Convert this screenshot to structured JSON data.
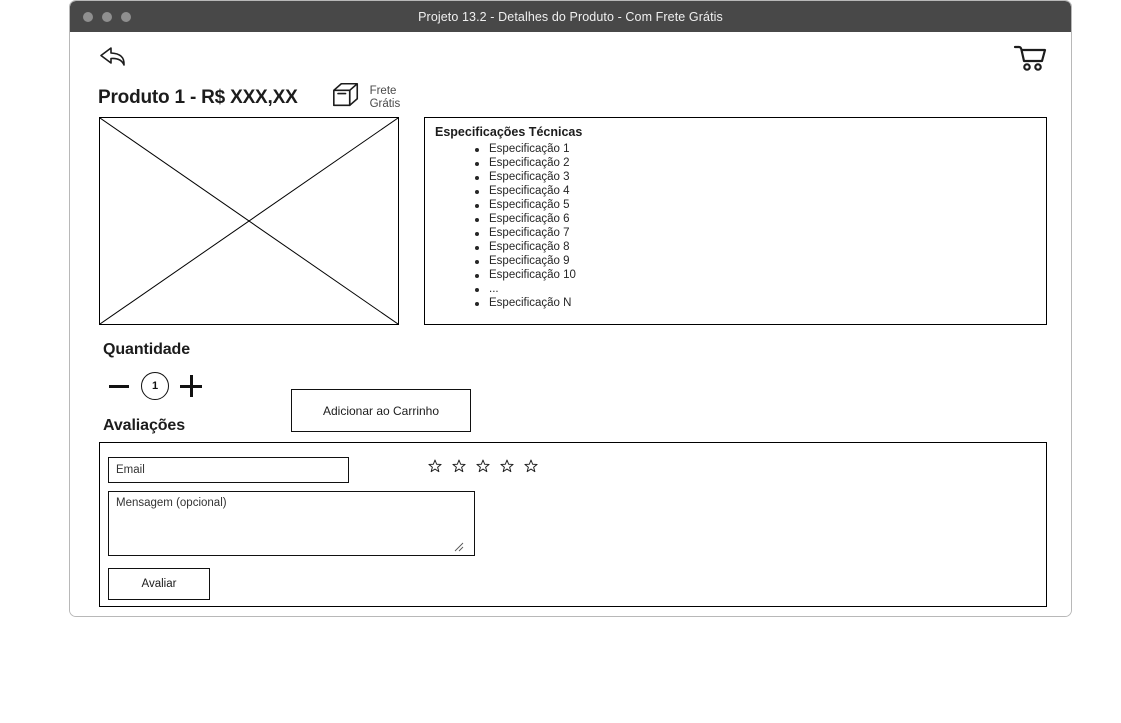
{
  "window": {
    "title": "Projeto 13.2 - Detalhes do Produto - Com Frete Grátis",
    "dots": [
      "close-dot",
      "minimize-dot",
      "maximize-dot"
    ]
  },
  "header": {
    "back_icon": "back-arrow-icon",
    "cart_icon": "shopping-cart-icon",
    "product_title": "Produto 1 - R$ XXX,XX",
    "freight_icon": "package-box-icon",
    "freight_line1": "Frete",
    "freight_line2": "Grátis"
  },
  "media": {
    "image_placeholder": "image-placeholder-crossed-box"
  },
  "specs": {
    "title": "Especificações Técnicas",
    "items": [
      "Especificação 1",
      "Especificação 2",
      "Especificação 3",
      "Especificação 4",
      "Especificação 5",
      "Especificação 6",
      "Especificação 7",
      "Especificação 8",
      "Especificação 9",
      "Especificação 10",
      "...",
      "Especificação N"
    ]
  },
  "quantity": {
    "heading": "Quantidade",
    "decrement_label": "−",
    "value": "1",
    "increment_label": "+",
    "add_to_cart_label": "Adicionar ao Carrinho"
  },
  "reviews": {
    "heading": "Avaliações",
    "email_placeholder": "Email",
    "email_value": "",
    "message_placeholder": "Mensagem (opcional)",
    "message_value": "",
    "stars_count": 5,
    "stars_filled": 0,
    "submit_label": "Avaliar"
  },
  "colors": {
    "titlebar": "#484848",
    "titlebar_text": "#f0f0f0",
    "dot": "#8f8f8f",
    "outline": "#000000",
    "text": "#1c1c1c",
    "window_border": "#b8b8b8",
    "background": "#ffffff"
  }
}
